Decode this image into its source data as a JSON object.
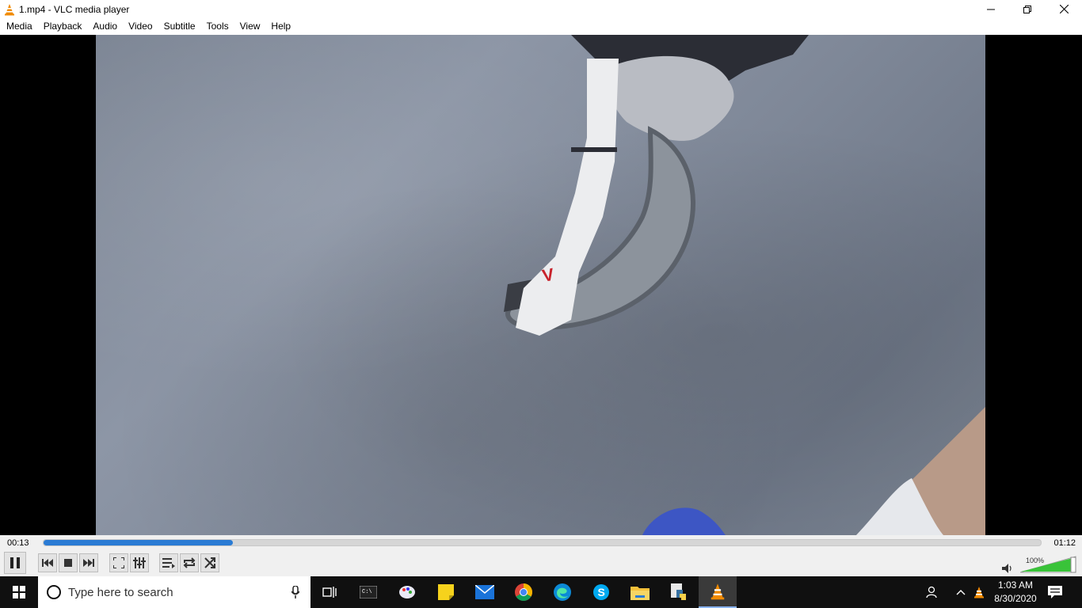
{
  "window": {
    "title": "1.mp4 - VLC media player"
  },
  "menu": [
    "Media",
    "Playback",
    "Audio",
    "Video",
    "Subtitle",
    "Tools",
    "View",
    "Help"
  ],
  "player": {
    "elapsed": "00:13",
    "duration": "01:12",
    "progress": 0.19,
    "volume_label": "100%",
    "volume": 1.0,
    "accent": "#2a7bd4",
    "state": "playing"
  },
  "taskbar": {
    "search_placeholder": "Type here to search",
    "time": "1:03 AM",
    "date": "8/30/2020",
    "apps": [
      "task-view-icon",
      "terminal-icon",
      "paint-icon",
      "sticky-notes-icon",
      "mail-icon",
      "chrome-icon",
      "edge-icon",
      "skype-icon",
      "file-explorer-icon",
      "python-icon",
      "vlc-icon"
    ]
  }
}
